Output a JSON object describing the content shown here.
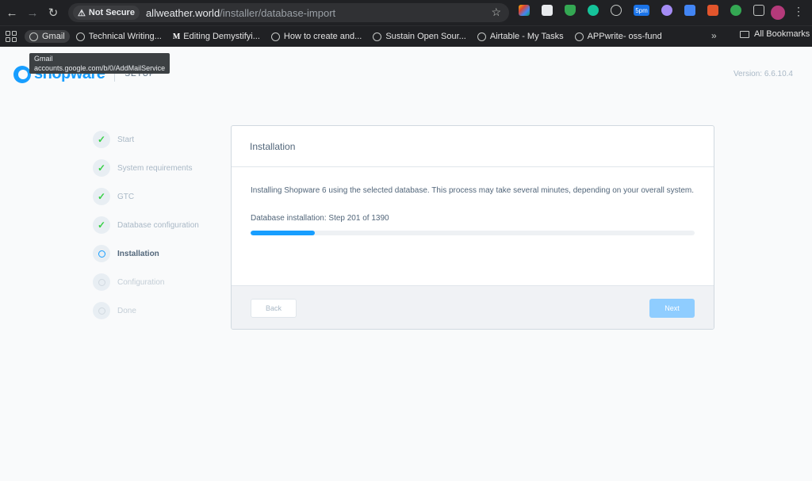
{
  "browser": {
    "security_label": "Not Secure",
    "url_host": "allweather.world",
    "url_path": "/installer/database-import",
    "extension_badge": "5pm",
    "bookmarks": [
      {
        "label": "Gmail"
      },
      {
        "label": "Technical Writing..."
      },
      {
        "label": "Editing Demystifyi..."
      },
      {
        "label": "How to create and..."
      },
      {
        "label": "Sustain Open Sour..."
      },
      {
        "label": "Airtable - My Tasks"
      },
      {
        "label": "APPwrite- oss-fund"
      }
    ],
    "bookmarks_more": "»",
    "all_bookmarks": "All Bookmarks",
    "tooltip": {
      "title": "Gmail",
      "url": "accounts.google.com/b/0/AddMailService"
    }
  },
  "header": {
    "logo_text": "shopware",
    "setup_label": "SETUP",
    "version": "Version: 6.6.10.4"
  },
  "steps": [
    {
      "label": "Start",
      "status": "done"
    },
    {
      "label": "System requirements",
      "status": "done"
    },
    {
      "label": "GTC",
      "status": "done"
    },
    {
      "label": "Database configuration",
      "status": "done"
    },
    {
      "label": "Installation",
      "status": "current"
    },
    {
      "label": "Configuration",
      "status": "pending"
    },
    {
      "label": "Done",
      "status": "pending"
    }
  ],
  "card": {
    "title": "Installation",
    "description": "Installing Shopware 6 using the selected database. This process may take several minutes, depending on your overall system.",
    "progress_label": "Database installation: Step 201 of 1390",
    "progress_fraction": 0.145,
    "back_label": "Back",
    "next_label": "Next"
  },
  "colors": {
    "brand": "#189eff",
    "check": "#37d046",
    "next_disabled": "#8fcdff"
  }
}
